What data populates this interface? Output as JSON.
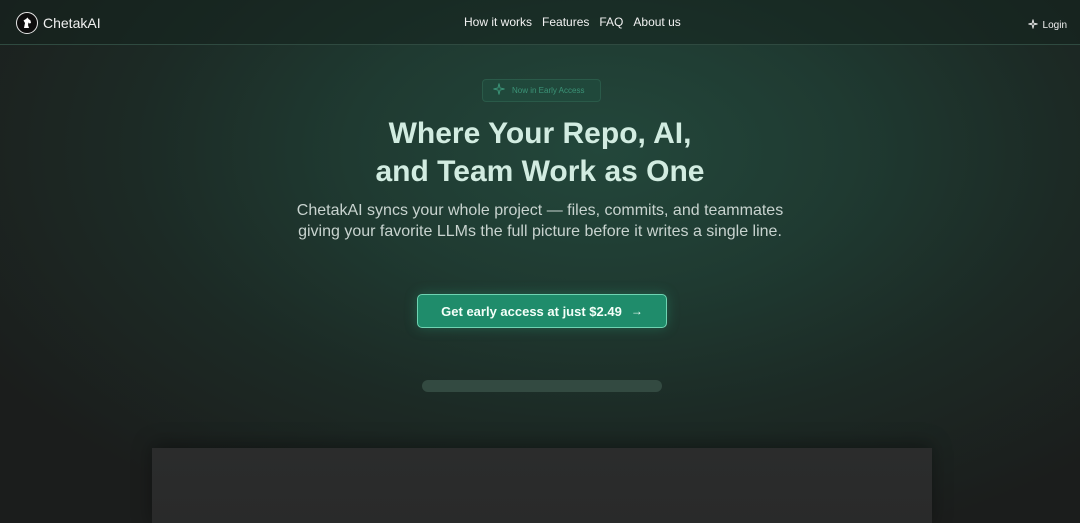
{
  "brand": {
    "name": "ChetakAI",
    "logo_icon": "horse-head-icon"
  },
  "nav": {
    "links": [
      "How it works",
      "Features",
      "FAQ",
      "About us"
    ],
    "login_label": "Login",
    "login_icon": "sparkle-icon"
  },
  "hero": {
    "badge_label": "Now in Early Access",
    "badge_icon": "sparkle-icon",
    "headline_line1": "Where Your Repo, AI,",
    "headline_line2": "and Team Work as One",
    "subtitle_line1": "ChetakAI syncs your whole project — files, commits, and teammates",
    "subtitle_line2": "giving your favorite LLMs the full picture before it writes a single line.",
    "cta_label": "Get early access at just $2.49",
    "cta_arrow": "→"
  },
  "colors": {
    "accent": "#1f8c6b",
    "accent_border": "#6fd3b2",
    "headline": "#d2ece1",
    "background": "#1b1d1c"
  }
}
